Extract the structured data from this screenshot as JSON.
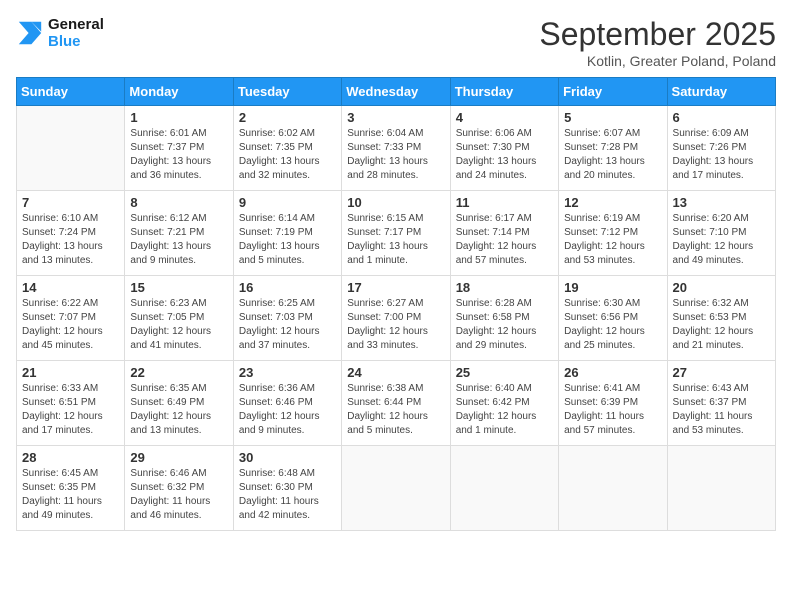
{
  "logo": {
    "line1": "General",
    "line2": "Blue"
  },
  "title": "September 2025",
  "subtitle": "Kotlin, Greater Poland, Poland",
  "headers": [
    "Sunday",
    "Monday",
    "Tuesday",
    "Wednesday",
    "Thursday",
    "Friday",
    "Saturday"
  ],
  "weeks": [
    [
      {
        "day": "",
        "detail": ""
      },
      {
        "day": "1",
        "detail": "Sunrise: 6:01 AM\nSunset: 7:37 PM\nDaylight: 13 hours\nand 36 minutes."
      },
      {
        "day": "2",
        "detail": "Sunrise: 6:02 AM\nSunset: 7:35 PM\nDaylight: 13 hours\nand 32 minutes."
      },
      {
        "day": "3",
        "detail": "Sunrise: 6:04 AM\nSunset: 7:33 PM\nDaylight: 13 hours\nand 28 minutes."
      },
      {
        "day": "4",
        "detail": "Sunrise: 6:06 AM\nSunset: 7:30 PM\nDaylight: 13 hours\nand 24 minutes."
      },
      {
        "day": "5",
        "detail": "Sunrise: 6:07 AM\nSunset: 7:28 PM\nDaylight: 13 hours\nand 20 minutes."
      },
      {
        "day": "6",
        "detail": "Sunrise: 6:09 AM\nSunset: 7:26 PM\nDaylight: 13 hours\nand 17 minutes."
      }
    ],
    [
      {
        "day": "7",
        "detail": "Sunrise: 6:10 AM\nSunset: 7:24 PM\nDaylight: 13 hours\nand 13 minutes."
      },
      {
        "day": "8",
        "detail": "Sunrise: 6:12 AM\nSunset: 7:21 PM\nDaylight: 13 hours\nand 9 minutes."
      },
      {
        "day": "9",
        "detail": "Sunrise: 6:14 AM\nSunset: 7:19 PM\nDaylight: 13 hours\nand 5 minutes."
      },
      {
        "day": "10",
        "detail": "Sunrise: 6:15 AM\nSunset: 7:17 PM\nDaylight: 13 hours\nand 1 minute."
      },
      {
        "day": "11",
        "detail": "Sunrise: 6:17 AM\nSunset: 7:14 PM\nDaylight: 12 hours\nand 57 minutes."
      },
      {
        "day": "12",
        "detail": "Sunrise: 6:19 AM\nSunset: 7:12 PM\nDaylight: 12 hours\nand 53 minutes."
      },
      {
        "day": "13",
        "detail": "Sunrise: 6:20 AM\nSunset: 7:10 PM\nDaylight: 12 hours\nand 49 minutes."
      }
    ],
    [
      {
        "day": "14",
        "detail": "Sunrise: 6:22 AM\nSunset: 7:07 PM\nDaylight: 12 hours\nand 45 minutes."
      },
      {
        "day": "15",
        "detail": "Sunrise: 6:23 AM\nSunset: 7:05 PM\nDaylight: 12 hours\nand 41 minutes."
      },
      {
        "day": "16",
        "detail": "Sunrise: 6:25 AM\nSunset: 7:03 PM\nDaylight: 12 hours\nand 37 minutes."
      },
      {
        "day": "17",
        "detail": "Sunrise: 6:27 AM\nSunset: 7:00 PM\nDaylight: 12 hours\nand 33 minutes."
      },
      {
        "day": "18",
        "detail": "Sunrise: 6:28 AM\nSunset: 6:58 PM\nDaylight: 12 hours\nand 29 minutes."
      },
      {
        "day": "19",
        "detail": "Sunrise: 6:30 AM\nSunset: 6:56 PM\nDaylight: 12 hours\nand 25 minutes."
      },
      {
        "day": "20",
        "detail": "Sunrise: 6:32 AM\nSunset: 6:53 PM\nDaylight: 12 hours\nand 21 minutes."
      }
    ],
    [
      {
        "day": "21",
        "detail": "Sunrise: 6:33 AM\nSunset: 6:51 PM\nDaylight: 12 hours\nand 17 minutes."
      },
      {
        "day": "22",
        "detail": "Sunrise: 6:35 AM\nSunset: 6:49 PM\nDaylight: 12 hours\nand 13 minutes."
      },
      {
        "day": "23",
        "detail": "Sunrise: 6:36 AM\nSunset: 6:46 PM\nDaylight: 12 hours\nand 9 minutes."
      },
      {
        "day": "24",
        "detail": "Sunrise: 6:38 AM\nSunset: 6:44 PM\nDaylight: 12 hours\nand 5 minutes."
      },
      {
        "day": "25",
        "detail": "Sunrise: 6:40 AM\nSunset: 6:42 PM\nDaylight: 12 hours\nand 1 minute."
      },
      {
        "day": "26",
        "detail": "Sunrise: 6:41 AM\nSunset: 6:39 PM\nDaylight: 11 hours\nand 57 minutes."
      },
      {
        "day": "27",
        "detail": "Sunrise: 6:43 AM\nSunset: 6:37 PM\nDaylight: 11 hours\nand 53 minutes."
      }
    ],
    [
      {
        "day": "28",
        "detail": "Sunrise: 6:45 AM\nSunset: 6:35 PM\nDaylight: 11 hours\nand 49 minutes."
      },
      {
        "day": "29",
        "detail": "Sunrise: 6:46 AM\nSunset: 6:32 PM\nDaylight: 11 hours\nand 46 minutes."
      },
      {
        "day": "30",
        "detail": "Sunrise: 6:48 AM\nSunset: 6:30 PM\nDaylight: 11 hours\nand 42 minutes."
      },
      {
        "day": "",
        "detail": ""
      },
      {
        "day": "",
        "detail": ""
      },
      {
        "day": "",
        "detail": ""
      },
      {
        "day": "",
        "detail": ""
      }
    ]
  ]
}
